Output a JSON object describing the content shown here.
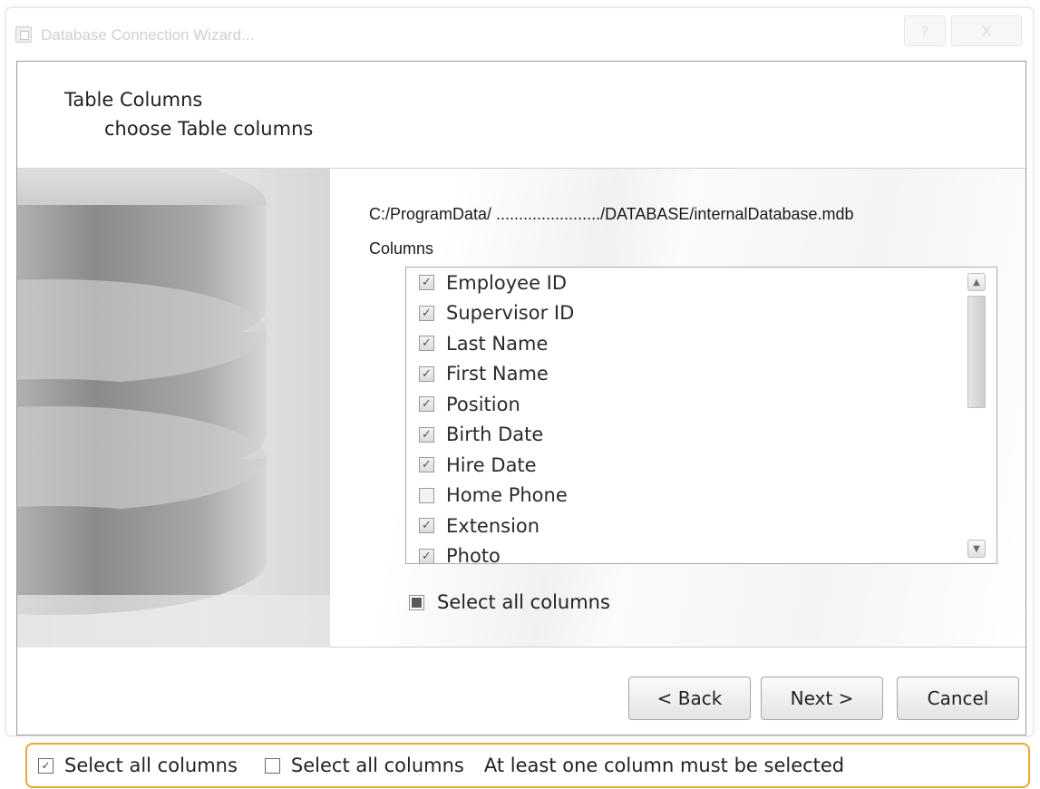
{
  "window": {
    "title": "Database Connection Wizard...",
    "help_label": "?",
    "close_label": "X"
  },
  "header": {
    "title": "Table Columns",
    "subtitle": "choose Table columns"
  },
  "main": {
    "path": "C:/ProgramData/ ......................./DATABASE/internalDatabase.mdb",
    "columns_label": "Columns",
    "columns": [
      {
        "label": "Employee ID",
        "checked": true
      },
      {
        "label": "Supervisor ID",
        "checked": true
      },
      {
        "label": "Last Name",
        "checked": true
      },
      {
        "label": "First Name",
        "checked": true
      },
      {
        "label": "Position",
        "checked": true
      },
      {
        "label": "Birth Date",
        "checked": true
      },
      {
        "label": "Hire Date",
        "checked": true
      },
      {
        "label": "Home Phone",
        "checked": false
      },
      {
        "label": "Extension",
        "checked": true
      },
      {
        "label": "Photo",
        "checked": true
      }
    ],
    "select_all_label": "Select all columns",
    "select_all_state": "indeterminate"
  },
  "footer": {
    "back_label": "< Back",
    "next_label": "Next >",
    "cancel_label": "Cancel"
  },
  "legend": {
    "checked_label": "Select all columns",
    "unchecked_label": "Select all columns",
    "note": "At least one column must be selected",
    "border_color": "#f0a43a"
  },
  "icons": {
    "checkmark": "check-icon",
    "scroll_up": "arrow-up-icon",
    "scroll_down": "arrow-down-icon",
    "side_image": "database-cylinder-icon"
  }
}
